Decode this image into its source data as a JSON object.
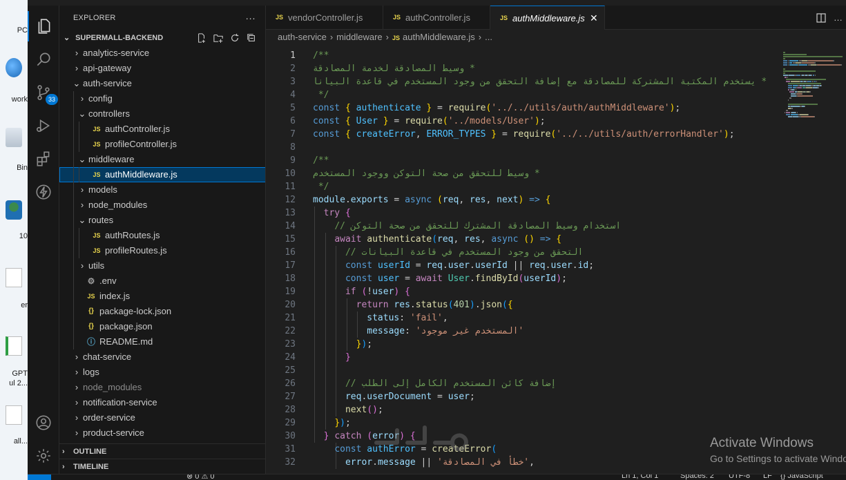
{
  "desktop": {
    "icons": [
      "PC",
      "work",
      "Bin",
      "10",
      "er",
      "GPT",
      "ul 2...",
      "all..."
    ]
  },
  "titlebar": {
    "title": "supermall-backend"
  },
  "activity_bar": {
    "items": [
      "explorer-icon",
      "search-icon",
      "source-control-icon",
      "run-debug-icon",
      "extensions-icon",
      "lightning-icon"
    ],
    "source_control_badge": "33",
    "bottom": [
      "account-icon",
      "settings-icon"
    ]
  },
  "sidebar": {
    "title": "EXPLORER",
    "more": "···",
    "root": "SUPERMALL-BACKEND",
    "tree": [
      {
        "label": "analytics-service",
        "depth": 0,
        "type": "folder",
        "open": false
      },
      {
        "label": "api-gateway",
        "depth": 0,
        "type": "folder",
        "open": false
      },
      {
        "label": "auth-service",
        "depth": 0,
        "type": "folder",
        "open": true
      },
      {
        "label": "config",
        "depth": 1,
        "type": "folder",
        "open": false
      },
      {
        "label": "controllers",
        "depth": 1,
        "type": "folder",
        "open": true
      },
      {
        "label": "authController.js",
        "depth": 2,
        "type": "js"
      },
      {
        "label": "profileController.js",
        "depth": 2,
        "type": "js"
      },
      {
        "label": "middleware",
        "depth": 1,
        "type": "folder",
        "open": true
      },
      {
        "label": "authMiddleware.js",
        "depth": 2,
        "type": "js",
        "selected": true
      },
      {
        "label": "models",
        "depth": 1,
        "type": "folder",
        "open": false
      },
      {
        "label": "node_modules",
        "depth": 1,
        "type": "folder",
        "open": false
      },
      {
        "label": "routes",
        "depth": 1,
        "type": "folder",
        "open": true
      },
      {
        "label": "authRoutes.js",
        "depth": 2,
        "type": "js"
      },
      {
        "label": "profileRoutes.js",
        "depth": 2,
        "type": "js"
      },
      {
        "label": "utils",
        "depth": 1,
        "type": "folder",
        "open": false
      },
      {
        "label": ".env",
        "depth": 1,
        "type": "env"
      },
      {
        "label": "index.js",
        "depth": 1,
        "type": "js"
      },
      {
        "label": "package-lock.json",
        "depth": 1,
        "type": "json"
      },
      {
        "label": "package.json",
        "depth": 1,
        "type": "json"
      },
      {
        "label": "README.md",
        "depth": 1,
        "type": "md"
      },
      {
        "label": "chat-service",
        "depth": 0,
        "type": "folder",
        "open": false
      },
      {
        "label": "logs",
        "depth": 0,
        "type": "folder",
        "open": false
      },
      {
        "label": "node_modules",
        "depth": 0,
        "type": "folder",
        "open": false,
        "dim": true
      },
      {
        "label": "notification-service",
        "depth": 0,
        "type": "folder",
        "open": false
      },
      {
        "label": "order-service",
        "depth": 0,
        "type": "folder",
        "open": false
      },
      {
        "label": "product-service",
        "depth": 0,
        "type": "folder",
        "open": false
      }
    ],
    "sections": [
      "OUTLINE",
      "TIMELINE"
    ]
  },
  "tabs": [
    {
      "label": "vendorController.js",
      "active": false
    },
    {
      "label": "authController.js",
      "active": false
    },
    {
      "label": "authMiddleware.js",
      "active": true
    }
  ],
  "breadcrumb": [
    "auth-service",
    "middleware",
    "authMiddleware.js",
    "..."
  ],
  "code": {
    "current_line": 1,
    "lines": [
      {
        "n": 1,
        "tokens": [
          [
            "cm",
            "/**"
          ]
        ]
      },
      {
        "n": 2,
        "rtl": true,
        "tokens": [
          [
            "cm",
            " * وسيط المصادقة لخدمة المصادقة"
          ]
        ]
      },
      {
        "n": 3,
        "rtl": true,
        "tokens": [
          [
            "cm",
            " * يستخدم المكتبة المشتركة للمصادقة مع إضافة التحقق من وجود المستخدم في قاعدة البيانات"
          ]
        ]
      },
      {
        "n": 4,
        "tokens": [
          [
            "cm",
            " */"
          ]
        ]
      },
      {
        "n": 5,
        "tokens": [
          [
            "kw",
            "const"
          ],
          [
            "",
            " "
          ],
          [
            "br1",
            "{"
          ],
          [
            "",
            " "
          ],
          [
            "cn",
            "authenticate"
          ],
          [
            "",
            " "
          ],
          [
            "br1",
            "}"
          ],
          [
            "",
            " = "
          ],
          [
            "fn",
            "require"
          ],
          [
            "br1",
            "("
          ],
          [
            "st",
            "'../../utils/auth/authMiddleware'"
          ],
          [
            "br1",
            ")"
          ],
          [
            "",
            ";"
          ]
        ]
      },
      {
        "n": 6,
        "tokens": [
          [
            "kw",
            "const"
          ],
          [
            "",
            " "
          ],
          [
            "br1",
            "{"
          ],
          [
            "",
            " "
          ],
          [
            "cn",
            "User"
          ],
          [
            "",
            " "
          ],
          [
            "br1",
            "}"
          ],
          [
            "",
            " = "
          ],
          [
            "fn",
            "require"
          ],
          [
            "br1",
            "("
          ],
          [
            "st",
            "'../models/User'"
          ],
          [
            "br1",
            ")"
          ],
          [
            "",
            ";"
          ]
        ]
      },
      {
        "n": 7,
        "tokens": [
          [
            "kw",
            "const"
          ],
          [
            "",
            " "
          ],
          [
            "br1",
            "{"
          ],
          [
            "",
            " "
          ],
          [
            "cn",
            "createError"
          ],
          [
            "",
            ", "
          ],
          [
            "cn",
            "ERROR_TYPES"
          ],
          [
            "",
            " "
          ],
          [
            "br1",
            "}"
          ],
          [
            "",
            " = "
          ],
          [
            "fn",
            "require"
          ],
          [
            "br1",
            "("
          ],
          [
            "st",
            "'../../utils/auth/errorHandler'"
          ],
          [
            "br1",
            ")"
          ],
          [
            "",
            ";"
          ]
        ]
      },
      {
        "n": 8,
        "tokens": []
      },
      {
        "n": 9,
        "tokens": [
          [
            "cm",
            "/**"
          ]
        ]
      },
      {
        "n": 10,
        "rtl": true,
        "tokens": [
          [
            "cm",
            " * وسيط للتحقق من صحة التوكن ووجود المستخدم"
          ]
        ]
      },
      {
        "n": 11,
        "tokens": [
          [
            "cm",
            " */"
          ]
        ]
      },
      {
        "n": 12,
        "tokens": [
          [
            "vr",
            "module"
          ],
          [
            "",
            "."
          ],
          [
            "vr",
            "exports"
          ],
          [
            "",
            " = "
          ],
          [
            "kw",
            "async"
          ],
          [
            "",
            " "
          ],
          [
            "br1",
            "("
          ],
          [
            "vr",
            "req"
          ],
          [
            "",
            ", "
          ],
          [
            "vr",
            "res"
          ],
          [
            "",
            ", "
          ],
          [
            "vr",
            "next"
          ],
          [
            "br1",
            ")"
          ],
          [
            "",
            " "
          ],
          [
            "kw",
            "=>"
          ],
          [
            "",
            " "
          ],
          [
            "br1",
            "{"
          ]
        ]
      },
      {
        "n": 13,
        "tokens": [
          [
            "",
            "  "
          ],
          [
            "ctl",
            "try"
          ],
          [
            "",
            " "
          ],
          [
            "br2",
            "{"
          ]
        ]
      },
      {
        "n": 14,
        "tokens": [
          [
            "",
            "    "
          ],
          [
            "cm",
            "// استخدام وسيط المصادقة المشترك للتحقق من صحة التوكن"
          ]
        ]
      },
      {
        "n": 15,
        "tokens": [
          [
            "",
            "    "
          ],
          [
            "ctl",
            "await"
          ],
          [
            "",
            " "
          ],
          [
            "fn",
            "authenticate"
          ],
          [
            "br3",
            "("
          ],
          [
            "vr",
            "req"
          ],
          [
            "",
            ", "
          ],
          [
            "vr",
            "res"
          ],
          [
            "",
            ", "
          ],
          [
            "kw",
            "async"
          ],
          [
            "",
            " "
          ],
          [
            "br1",
            "()"
          ],
          [
            "",
            " "
          ],
          [
            "kw",
            "=>"
          ],
          [
            "",
            " "
          ],
          [
            "br1",
            "{"
          ]
        ]
      },
      {
        "n": 16,
        "tokens": [
          [
            "",
            "      "
          ],
          [
            "cm",
            "// التحقق من وجود المستخدم في قاعدة البيانات"
          ]
        ]
      },
      {
        "n": 17,
        "tokens": [
          [
            "",
            "      "
          ],
          [
            "kw",
            "const"
          ],
          [
            "",
            " "
          ],
          [
            "cn",
            "userId"
          ],
          [
            "",
            " = "
          ],
          [
            "vr",
            "req"
          ],
          [
            "",
            "."
          ],
          [
            "vr",
            "user"
          ],
          [
            "",
            "."
          ],
          [
            "vr",
            "userId"
          ],
          [
            "",
            " || "
          ],
          [
            "vr",
            "req"
          ],
          [
            "",
            "."
          ],
          [
            "vr",
            "user"
          ],
          [
            "",
            "."
          ],
          [
            "vr",
            "id"
          ],
          [
            "",
            ";"
          ]
        ]
      },
      {
        "n": 18,
        "tokens": [
          [
            "",
            "      "
          ],
          [
            "kw",
            "const"
          ],
          [
            "",
            " "
          ],
          [
            "cn",
            "user"
          ],
          [
            "",
            " = "
          ],
          [
            "ctl",
            "await"
          ],
          [
            "",
            " "
          ],
          [
            "tp",
            "User"
          ],
          [
            "",
            "."
          ],
          [
            "fn",
            "findById"
          ],
          [
            "br2",
            "("
          ],
          [
            "vr",
            "userId"
          ],
          [
            "br2",
            ")"
          ],
          [
            "",
            ";"
          ]
        ]
      },
      {
        "n": 19,
        "tokens": [
          [
            "",
            "      "
          ],
          [
            "ctl",
            "if"
          ],
          [
            "",
            " "
          ],
          [
            "br2",
            "("
          ],
          [
            "",
            "!"
          ],
          [
            "vr",
            "user"
          ],
          [
            "br2",
            ")"
          ],
          [
            "",
            " "
          ],
          [
            "br2",
            "{"
          ]
        ]
      },
      {
        "n": 20,
        "tokens": [
          [
            "",
            "        "
          ],
          [
            "ctl",
            "return"
          ],
          [
            "",
            " "
          ],
          [
            "vr",
            "res"
          ],
          [
            "",
            "."
          ],
          [
            "fn",
            "status"
          ],
          [
            "br3",
            "("
          ],
          [
            "nm",
            "401"
          ],
          [
            "br3",
            ")"
          ],
          [
            "",
            "."
          ],
          [
            "fn",
            "json"
          ],
          [
            "br3",
            "("
          ],
          [
            "br1",
            "{"
          ]
        ]
      },
      {
        "n": 21,
        "tokens": [
          [
            "",
            "          "
          ],
          [
            "vr",
            "status"
          ],
          [
            "",
            ": "
          ],
          [
            "st",
            "'fail'"
          ],
          [
            "",
            ","
          ]
        ]
      },
      {
        "n": 22,
        "tokens": [
          [
            "",
            "          "
          ],
          [
            "vr",
            "message"
          ],
          [
            "",
            ": "
          ],
          [
            "st",
            "'المستخدم غير موجود'"
          ]
        ]
      },
      {
        "n": 23,
        "tokens": [
          [
            "",
            "        "
          ],
          [
            "br1",
            "}"
          ],
          [
            "br3",
            ")"
          ],
          [
            "",
            ";"
          ]
        ]
      },
      {
        "n": 24,
        "tokens": [
          [
            "",
            "      "
          ],
          [
            "br2",
            "}"
          ]
        ]
      },
      {
        "n": 25,
        "tokens": []
      },
      {
        "n": 26,
        "tokens": [
          [
            "",
            "      "
          ],
          [
            "cm",
            "// إضافة كائن المستخدم الكامل إلى الطلب"
          ]
        ]
      },
      {
        "n": 27,
        "tokens": [
          [
            "",
            "      "
          ],
          [
            "vr",
            "req"
          ],
          [
            "",
            "."
          ],
          [
            "vr",
            "userDocument"
          ],
          [
            "",
            " = "
          ],
          [
            "vr",
            "user"
          ],
          [
            "",
            ";"
          ]
        ]
      },
      {
        "n": 28,
        "tokens": [
          [
            "",
            "      "
          ],
          [
            "fn",
            "next"
          ],
          [
            "br2",
            "()"
          ],
          [
            "",
            ";"
          ]
        ]
      },
      {
        "n": 29,
        "tokens": [
          [
            "",
            "    "
          ],
          [
            "br1",
            "}"
          ],
          [
            "br3",
            ")"
          ],
          [
            "",
            ";"
          ]
        ]
      },
      {
        "n": 30,
        "tokens": [
          [
            "",
            "  "
          ],
          [
            "br2",
            "}"
          ],
          [
            "",
            " "
          ],
          [
            "ctl",
            "catch"
          ],
          [
            "",
            " "
          ],
          [
            "br2",
            "("
          ],
          [
            "vr",
            "error"
          ],
          [
            "br2",
            ")"
          ],
          [
            "",
            " "
          ],
          [
            "br2",
            "{"
          ]
        ]
      },
      {
        "n": 31,
        "tokens": [
          [
            "",
            "    "
          ],
          [
            "kw",
            "const"
          ],
          [
            "",
            " "
          ],
          [
            "cn",
            "authError"
          ],
          [
            "",
            " = "
          ],
          [
            "fn",
            "createError"
          ],
          [
            "br3",
            "("
          ]
        ]
      },
      {
        "n": 32,
        "tokens": [
          [
            "",
            "      "
          ],
          [
            "vr",
            "error"
          ],
          [
            "",
            "."
          ],
          [
            "vr",
            "message"
          ],
          [
            "",
            " || "
          ],
          [
            "st",
            "'خطأ في المصادقة'"
          ],
          [
            "",
            ","
          ]
        ]
      }
    ]
  },
  "watermark": {
    "line1": "Activate Windows",
    "line2": "Go to Settings to activate Windows."
  },
  "logo_watermark": "مستقل",
  "statusbar": {
    "items": [
      "⊗ 0 ⚠ 0",
      "Ln 1, Col 1",
      "Spaces: 2",
      "UTF-8",
      "LF",
      "{} JavaScript"
    ]
  }
}
